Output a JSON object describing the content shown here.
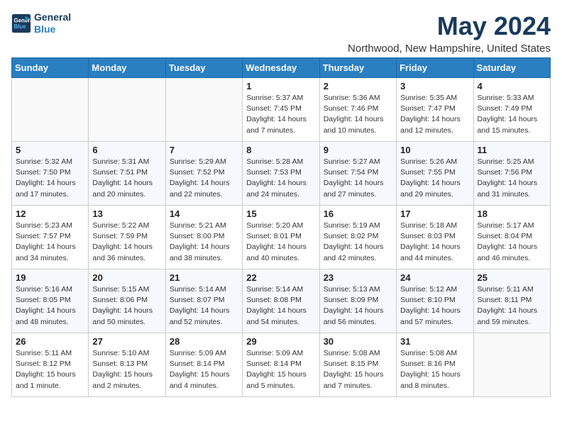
{
  "logo": {
    "line1": "General",
    "line2": "Blue"
  },
  "title": "May 2024",
  "subtitle": "Northwood, New Hampshire, United States",
  "days_header": [
    "Sunday",
    "Monday",
    "Tuesday",
    "Wednesday",
    "Thursday",
    "Friday",
    "Saturday"
  ],
  "weeks": [
    [
      {
        "day": "",
        "content": ""
      },
      {
        "day": "",
        "content": ""
      },
      {
        "day": "",
        "content": ""
      },
      {
        "day": "1",
        "content": "Sunrise: 5:37 AM\nSunset: 7:45 PM\nDaylight: 14 hours\nand 7 minutes."
      },
      {
        "day": "2",
        "content": "Sunrise: 5:36 AM\nSunset: 7:46 PM\nDaylight: 14 hours\nand 10 minutes."
      },
      {
        "day": "3",
        "content": "Sunrise: 5:35 AM\nSunset: 7:47 PM\nDaylight: 14 hours\nand 12 minutes."
      },
      {
        "day": "4",
        "content": "Sunrise: 5:33 AM\nSunset: 7:49 PM\nDaylight: 14 hours\nand 15 minutes."
      }
    ],
    [
      {
        "day": "5",
        "content": "Sunrise: 5:32 AM\nSunset: 7:50 PM\nDaylight: 14 hours\nand 17 minutes."
      },
      {
        "day": "6",
        "content": "Sunrise: 5:31 AM\nSunset: 7:51 PM\nDaylight: 14 hours\nand 20 minutes."
      },
      {
        "day": "7",
        "content": "Sunrise: 5:29 AM\nSunset: 7:52 PM\nDaylight: 14 hours\nand 22 minutes."
      },
      {
        "day": "8",
        "content": "Sunrise: 5:28 AM\nSunset: 7:53 PM\nDaylight: 14 hours\nand 24 minutes."
      },
      {
        "day": "9",
        "content": "Sunrise: 5:27 AM\nSunset: 7:54 PM\nDaylight: 14 hours\nand 27 minutes."
      },
      {
        "day": "10",
        "content": "Sunrise: 5:26 AM\nSunset: 7:55 PM\nDaylight: 14 hours\nand 29 minutes."
      },
      {
        "day": "11",
        "content": "Sunrise: 5:25 AM\nSunset: 7:56 PM\nDaylight: 14 hours\nand 31 minutes."
      }
    ],
    [
      {
        "day": "12",
        "content": "Sunrise: 5:23 AM\nSunset: 7:57 PM\nDaylight: 14 hours\nand 34 minutes."
      },
      {
        "day": "13",
        "content": "Sunrise: 5:22 AM\nSunset: 7:59 PM\nDaylight: 14 hours\nand 36 minutes."
      },
      {
        "day": "14",
        "content": "Sunrise: 5:21 AM\nSunset: 8:00 PM\nDaylight: 14 hours\nand 38 minutes."
      },
      {
        "day": "15",
        "content": "Sunrise: 5:20 AM\nSunset: 8:01 PM\nDaylight: 14 hours\nand 40 minutes."
      },
      {
        "day": "16",
        "content": "Sunrise: 5:19 AM\nSunset: 8:02 PM\nDaylight: 14 hours\nand 42 minutes."
      },
      {
        "day": "17",
        "content": "Sunrise: 5:18 AM\nSunset: 8:03 PM\nDaylight: 14 hours\nand 44 minutes."
      },
      {
        "day": "18",
        "content": "Sunrise: 5:17 AM\nSunset: 8:04 PM\nDaylight: 14 hours\nand 46 minutes."
      }
    ],
    [
      {
        "day": "19",
        "content": "Sunrise: 5:16 AM\nSunset: 8:05 PM\nDaylight: 14 hours\nand 48 minutes."
      },
      {
        "day": "20",
        "content": "Sunrise: 5:15 AM\nSunset: 8:06 PM\nDaylight: 14 hours\nand 50 minutes."
      },
      {
        "day": "21",
        "content": "Sunrise: 5:14 AM\nSunset: 8:07 PM\nDaylight: 14 hours\nand 52 minutes."
      },
      {
        "day": "22",
        "content": "Sunrise: 5:14 AM\nSunset: 8:08 PM\nDaylight: 14 hours\nand 54 minutes."
      },
      {
        "day": "23",
        "content": "Sunrise: 5:13 AM\nSunset: 8:09 PM\nDaylight: 14 hours\nand 56 minutes."
      },
      {
        "day": "24",
        "content": "Sunrise: 5:12 AM\nSunset: 8:10 PM\nDaylight: 14 hours\nand 57 minutes."
      },
      {
        "day": "25",
        "content": "Sunrise: 5:11 AM\nSunset: 8:11 PM\nDaylight: 14 hours\nand 59 minutes."
      }
    ],
    [
      {
        "day": "26",
        "content": "Sunrise: 5:11 AM\nSunset: 8:12 PM\nDaylight: 15 hours\nand 1 minute."
      },
      {
        "day": "27",
        "content": "Sunrise: 5:10 AM\nSunset: 8:13 PM\nDaylight: 15 hours\nand 2 minutes."
      },
      {
        "day": "28",
        "content": "Sunrise: 5:09 AM\nSunset: 8:14 PM\nDaylight: 15 hours\nand 4 minutes."
      },
      {
        "day": "29",
        "content": "Sunrise: 5:09 AM\nSunset: 8:14 PM\nDaylight: 15 hours\nand 5 minutes."
      },
      {
        "day": "30",
        "content": "Sunrise: 5:08 AM\nSunset: 8:15 PM\nDaylight: 15 hours\nand 7 minutes."
      },
      {
        "day": "31",
        "content": "Sunrise: 5:08 AM\nSunset: 8:16 PM\nDaylight: 15 hours\nand 8 minutes."
      },
      {
        "day": "",
        "content": ""
      }
    ]
  ]
}
